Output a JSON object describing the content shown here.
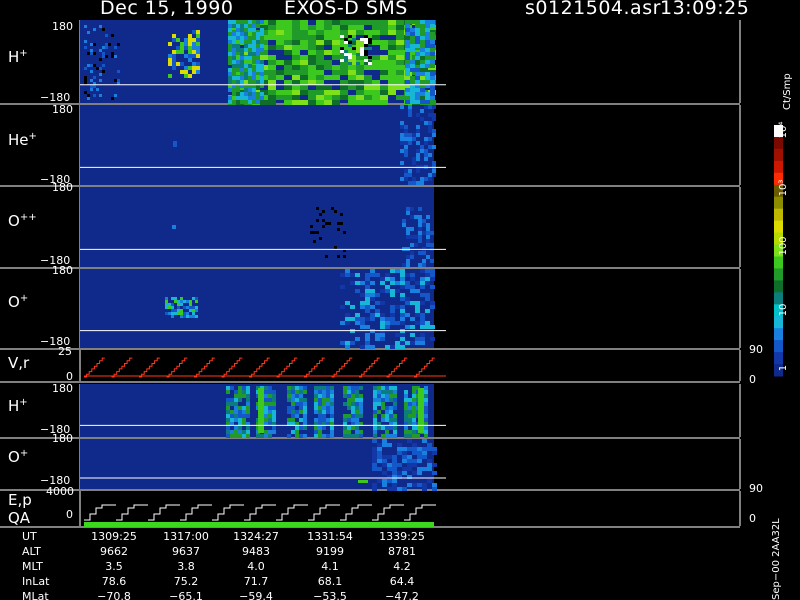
{
  "header": {
    "date": "Dec 15, 1990",
    "instrument": "EXOS-D SMS",
    "file": "s0121504.asr",
    "time": "13:09:25"
  },
  "panels": [
    {
      "label": "H",
      "charge": "+",
      "ymax": "180",
      "ymin": "−180"
    },
    {
      "label": "He",
      "charge": "+",
      "ymax": "180",
      "ymin": "−180"
    },
    {
      "label": "O",
      "charge": "++",
      "ymax": "180",
      "ymin": "−180"
    },
    {
      "label": "O",
      "charge": "+",
      "ymax": "180",
      "ymin": "−180"
    },
    {
      "label": "V,r",
      "ymax": "25",
      "ymin": "0",
      "rmax": "90",
      "rmin": "0"
    },
    {
      "label": "H",
      "charge": "+",
      "ymax": "180",
      "ymin": "−180"
    },
    {
      "label": "O",
      "charge": "+",
      "ymax": "180",
      "ymin": "−180"
    },
    {
      "label": "E,p",
      "label2": "QA",
      "ymax": "4000",
      "ymin": "0",
      "rmax": "90",
      "rmin": "0"
    }
  ],
  "colorbar": {
    "unit": "Ct/Smp",
    "tick_labels": [
      "1",
      "10",
      "100",
      "10³",
      "10⁴"
    ],
    "colors": [
      "#102a8c",
      "#1238a8",
      "#1457c8",
      "#1a80e0",
      "#18b6d6",
      "#00c0c8",
      "#0c7c7c",
      "#0e6e2a",
      "#209a28",
      "#3cc81e",
      "#7ee01a",
      "#b4dc00",
      "#dcdc00",
      "#c0b800",
      "#8c8c00",
      "#6a5a00",
      "#ff2a00",
      "#cc1800",
      "#a01000",
      "#7a0a00",
      "#ffffff"
    ]
  },
  "footer": {
    "code": "Sep−00 2AA32L",
    "row_labels": [
      "UT",
      "ALT",
      "MLT",
      "InLat",
      "MLat"
    ],
    "columns": [
      [
        "1309:25",
        "9662",
        "3.5",
        "78.6",
        "−70.8"
      ],
      [
        "1317:00",
        "9637",
        "3.8",
        "75.2",
        "−65.1"
      ],
      [
        "1324:27",
        "9483",
        "4.0",
        "71.7",
        "−59.4"
      ],
      [
        "1331:54",
        "9199",
        "4.1",
        "68.1",
        "−53.5"
      ],
      [
        "1339:25",
        "8781",
        "4.2",
        "64.4",
        "−47.2"
      ]
    ]
  },
  "chart_data": {
    "type": "heatmap",
    "x_axis": "UT",
    "x_ticks": [
      "1309:25",
      "1317:00",
      "1324:27",
      "1331:54",
      "1339:25"
    ],
    "panels": [
      {
        "name": "H+",
        "ylim": [
          -180,
          180
        ],
        "texture": "H1"
      },
      {
        "name": "He+",
        "ylim": [
          -180,
          180
        ],
        "texture": "He"
      },
      {
        "name": "O++",
        "ylim": [
          -180,
          180
        ],
        "texture": "Opp"
      },
      {
        "name": "O+",
        "ylim": [
          -180,
          180
        ],
        "texture": "Op"
      },
      {
        "name": "V,r",
        "ylim": [
          0,
          25
        ],
        "right_ylim": [
          0,
          90
        ],
        "type": "line"
      },
      {
        "name": "H+",
        "ylim": [
          -180,
          180
        ],
        "texture": "H2"
      },
      {
        "name": "O+",
        "ylim": [
          -180,
          180
        ],
        "texture": "O2"
      },
      {
        "name": "E,p / QA",
        "ylim": [
          0,
          4000
        ],
        "right_ylim": [
          0,
          90
        ],
        "type": "line"
      }
    ],
    "color_scale": "log",
    "color_range": [
      "1",
      "10⁴"
    ]
  }
}
